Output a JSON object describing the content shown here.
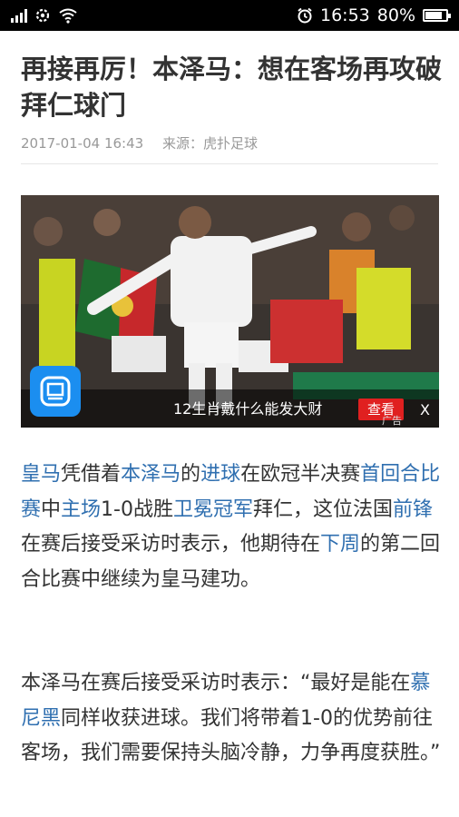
{
  "status_bar": {
    "time": "16:53",
    "battery_percent": "80%"
  },
  "article": {
    "title": "再接再厉！本泽马：想在客场再攻破拜仁球门",
    "date": "2017-01-04 16:43",
    "source": "来源：虎扑足球",
    "ad": {
      "text": "12生肖戴什么能发大财",
      "button": "查看",
      "tag": "广告",
      "close": "X"
    },
    "paragraphs": [
      [
        {
          "t": "皇马",
          "link": true
        },
        {
          "t": "凭借着",
          "link": false
        },
        {
          "t": "本泽马",
          "link": true
        },
        {
          "t": "的",
          "link": false
        },
        {
          "t": "进球",
          "link": true
        },
        {
          "t": "在欧冠半决赛",
          "link": false
        },
        {
          "t": "首回合比赛",
          "link": true
        },
        {
          "t": "中",
          "link": false
        },
        {
          "t": "主场",
          "link": true
        },
        {
          "t": "1-0战胜",
          "link": false
        },
        {
          "t": "卫冕冠军",
          "link": true
        },
        {
          "t": "拜仁，这位法国",
          "link": false
        },
        {
          "t": "前锋",
          "link": true
        },
        {
          "t": "在赛后接受采访时表示，他期待在",
          "link": false
        },
        {
          "t": "下周",
          "link": true
        },
        {
          "t": "的第二回合比赛中继续为皇马建功。",
          "link": false
        }
      ],
      [
        {
          "t": "本泽马在赛后接受采访时表示：“最好是能在",
          "link": false
        },
        {
          "t": "慕尼黑",
          "link": true
        },
        {
          "t": "同样收获进球。我们将带着1-0的优势前往客场，我们需要保持头脑冷静，力争再度获胜。”",
          "link": false
        }
      ]
    ]
  }
}
